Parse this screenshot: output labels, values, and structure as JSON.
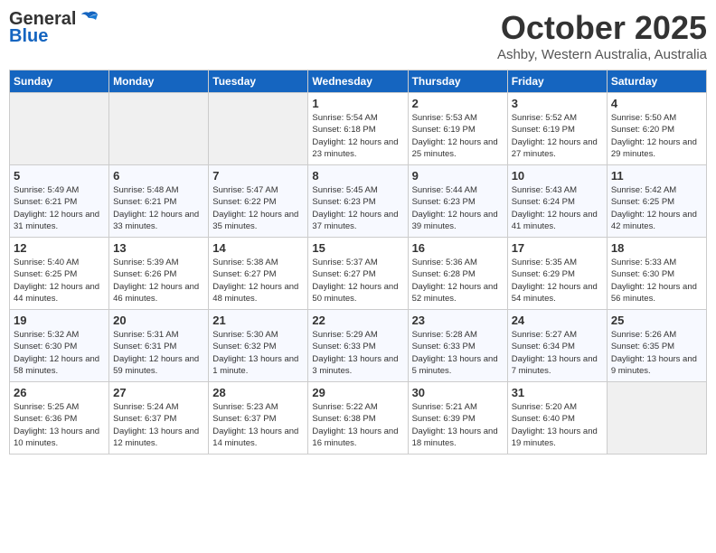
{
  "header": {
    "logo_general": "General",
    "logo_blue": "Blue",
    "month_title": "October 2025",
    "location": "Ashby, Western Australia, Australia"
  },
  "weekdays": [
    "Sunday",
    "Monday",
    "Tuesday",
    "Wednesday",
    "Thursday",
    "Friday",
    "Saturday"
  ],
  "weeks": [
    [
      {
        "day": "",
        "empty": true
      },
      {
        "day": "",
        "empty": true
      },
      {
        "day": "",
        "empty": true
      },
      {
        "day": "1",
        "sunrise": "Sunrise: 5:54 AM",
        "sunset": "Sunset: 6:18 PM",
        "daylight": "Daylight: 12 hours and 23 minutes."
      },
      {
        "day": "2",
        "sunrise": "Sunrise: 5:53 AM",
        "sunset": "Sunset: 6:19 PM",
        "daylight": "Daylight: 12 hours and 25 minutes."
      },
      {
        "day": "3",
        "sunrise": "Sunrise: 5:52 AM",
        "sunset": "Sunset: 6:19 PM",
        "daylight": "Daylight: 12 hours and 27 minutes."
      },
      {
        "day": "4",
        "sunrise": "Sunrise: 5:50 AM",
        "sunset": "Sunset: 6:20 PM",
        "daylight": "Daylight: 12 hours and 29 minutes."
      }
    ],
    [
      {
        "day": "5",
        "sunrise": "Sunrise: 5:49 AM",
        "sunset": "Sunset: 6:21 PM",
        "daylight": "Daylight: 12 hours and 31 minutes."
      },
      {
        "day": "6",
        "sunrise": "Sunrise: 5:48 AM",
        "sunset": "Sunset: 6:21 PM",
        "daylight": "Daylight: 12 hours and 33 minutes."
      },
      {
        "day": "7",
        "sunrise": "Sunrise: 5:47 AM",
        "sunset": "Sunset: 6:22 PM",
        "daylight": "Daylight: 12 hours and 35 minutes."
      },
      {
        "day": "8",
        "sunrise": "Sunrise: 5:45 AM",
        "sunset": "Sunset: 6:23 PM",
        "daylight": "Daylight: 12 hours and 37 minutes."
      },
      {
        "day": "9",
        "sunrise": "Sunrise: 5:44 AM",
        "sunset": "Sunset: 6:23 PM",
        "daylight": "Daylight: 12 hours and 39 minutes."
      },
      {
        "day": "10",
        "sunrise": "Sunrise: 5:43 AM",
        "sunset": "Sunset: 6:24 PM",
        "daylight": "Daylight: 12 hours and 41 minutes."
      },
      {
        "day": "11",
        "sunrise": "Sunrise: 5:42 AM",
        "sunset": "Sunset: 6:25 PM",
        "daylight": "Daylight: 12 hours and 42 minutes."
      }
    ],
    [
      {
        "day": "12",
        "sunrise": "Sunrise: 5:40 AM",
        "sunset": "Sunset: 6:25 PM",
        "daylight": "Daylight: 12 hours and 44 minutes."
      },
      {
        "day": "13",
        "sunrise": "Sunrise: 5:39 AM",
        "sunset": "Sunset: 6:26 PM",
        "daylight": "Daylight: 12 hours and 46 minutes."
      },
      {
        "day": "14",
        "sunrise": "Sunrise: 5:38 AM",
        "sunset": "Sunset: 6:27 PM",
        "daylight": "Daylight: 12 hours and 48 minutes."
      },
      {
        "day": "15",
        "sunrise": "Sunrise: 5:37 AM",
        "sunset": "Sunset: 6:27 PM",
        "daylight": "Daylight: 12 hours and 50 minutes."
      },
      {
        "day": "16",
        "sunrise": "Sunrise: 5:36 AM",
        "sunset": "Sunset: 6:28 PM",
        "daylight": "Daylight: 12 hours and 52 minutes."
      },
      {
        "day": "17",
        "sunrise": "Sunrise: 5:35 AM",
        "sunset": "Sunset: 6:29 PM",
        "daylight": "Daylight: 12 hours and 54 minutes."
      },
      {
        "day": "18",
        "sunrise": "Sunrise: 5:33 AM",
        "sunset": "Sunset: 6:30 PM",
        "daylight": "Daylight: 12 hours and 56 minutes."
      }
    ],
    [
      {
        "day": "19",
        "sunrise": "Sunrise: 5:32 AM",
        "sunset": "Sunset: 6:30 PM",
        "daylight": "Daylight: 12 hours and 58 minutes."
      },
      {
        "day": "20",
        "sunrise": "Sunrise: 5:31 AM",
        "sunset": "Sunset: 6:31 PM",
        "daylight": "Daylight: 12 hours and 59 minutes."
      },
      {
        "day": "21",
        "sunrise": "Sunrise: 5:30 AM",
        "sunset": "Sunset: 6:32 PM",
        "daylight": "Daylight: 13 hours and 1 minute."
      },
      {
        "day": "22",
        "sunrise": "Sunrise: 5:29 AM",
        "sunset": "Sunset: 6:33 PM",
        "daylight": "Daylight: 13 hours and 3 minutes."
      },
      {
        "day": "23",
        "sunrise": "Sunrise: 5:28 AM",
        "sunset": "Sunset: 6:33 PM",
        "daylight": "Daylight: 13 hours and 5 minutes."
      },
      {
        "day": "24",
        "sunrise": "Sunrise: 5:27 AM",
        "sunset": "Sunset: 6:34 PM",
        "daylight": "Daylight: 13 hours and 7 minutes."
      },
      {
        "day": "25",
        "sunrise": "Sunrise: 5:26 AM",
        "sunset": "Sunset: 6:35 PM",
        "daylight": "Daylight: 13 hours and 9 minutes."
      }
    ],
    [
      {
        "day": "26",
        "sunrise": "Sunrise: 5:25 AM",
        "sunset": "Sunset: 6:36 PM",
        "daylight": "Daylight: 13 hours and 10 minutes."
      },
      {
        "day": "27",
        "sunrise": "Sunrise: 5:24 AM",
        "sunset": "Sunset: 6:37 PM",
        "daylight": "Daylight: 13 hours and 12 minutes."
      },
      {
        "day": "28",
        "sunrise": "Sunrise: 5:23 AM",
        "sunset": "Sunset: 6:37 PM",
        "daylight": "Daylight: 13 hours and 14 minutes."
      },
      {
        "day": "29",
        "sunrise": "Sunrise: 5:22 AM",
        "sunset": "Sunset: 6:38 PM",
        "daylight": "Daylight: 13 hours and 16 minutes."
      },
      {
        "day": "30",
        "sunrise": "Sunrise: 5:21 AM",
        "sunset": "Sunset: 6:39 PM",
        "daylight": "Daylight: 13 hours and 18 minutes."
      },
      {
        "day": "31",
        "sunrise": "Sunrise: 5:20 AM",
        "sunset": "Sunset: 6:40 PM",
        "daylight": "Daylight: 13 hours and 19 minutes."
      },
      {
        "day": "",
        "empty": true
      }
    ]
  ]
}
